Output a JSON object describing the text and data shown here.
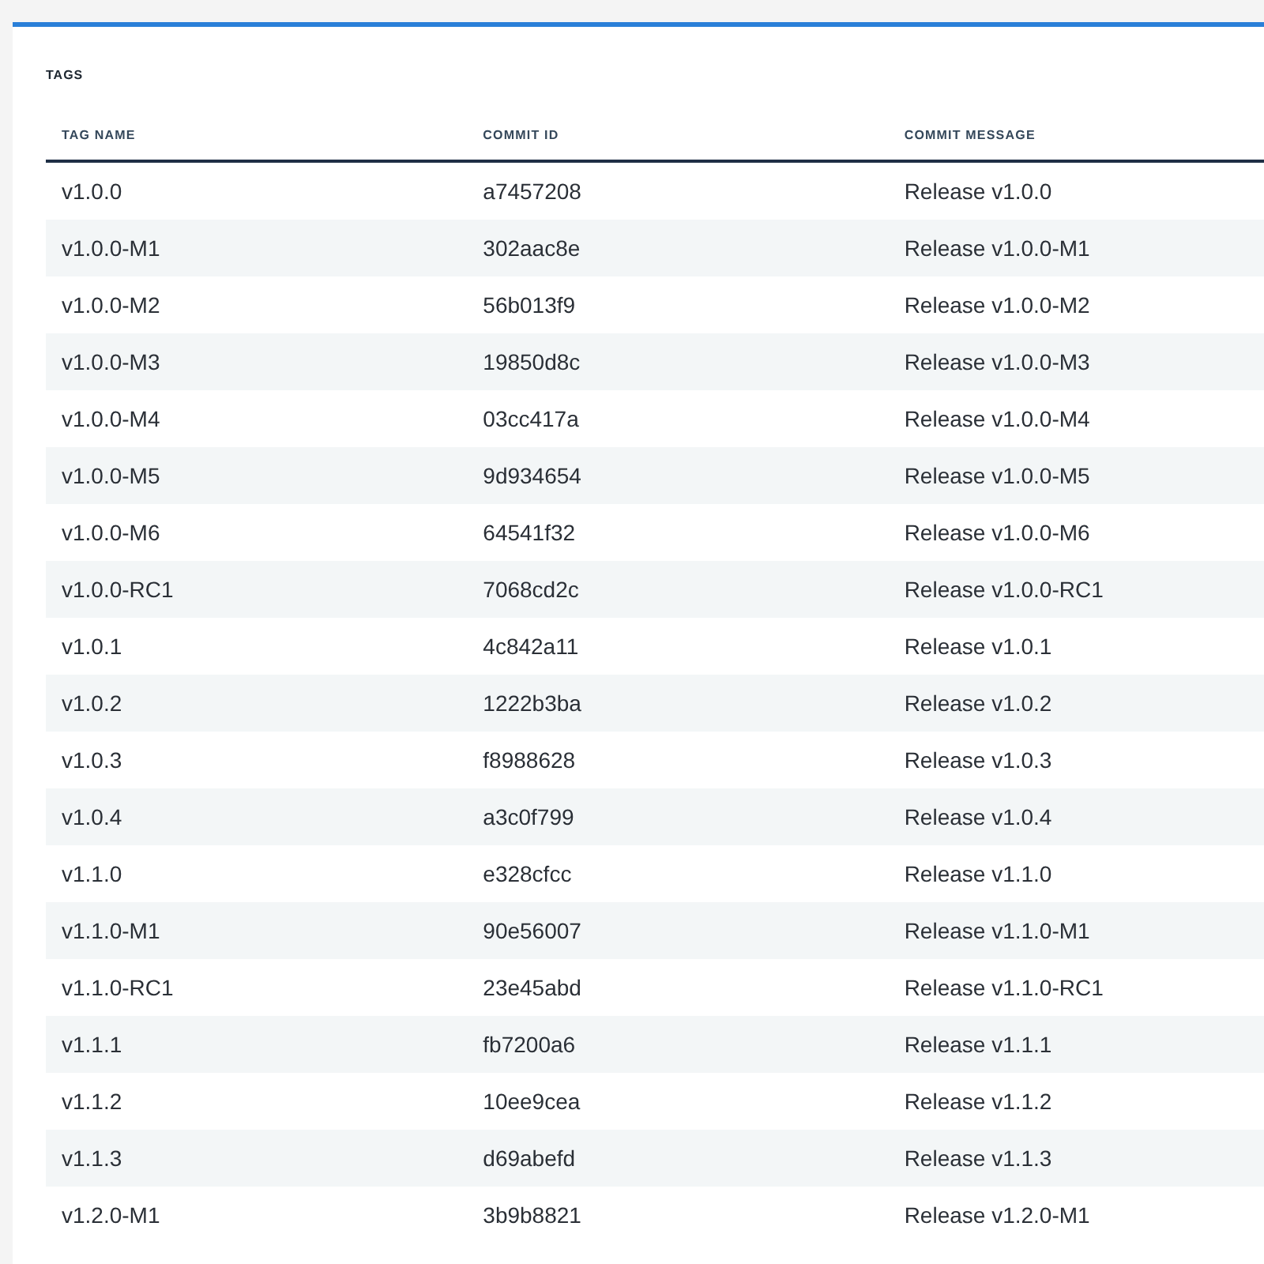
{
  "panel": {
    "title": "TAGS"
  },
  "table": {
    "columns": [
      "TAG NAME",
      "COMMIT ID",
      "COMMIT MESSAGE"
    ],
    "rows": [
      {
        "tag_name": "v1.0.0",
        "commit_id": "a7457208",
        "commit_message": "Release v1.0.0"
      },
      {
        "tag_name": "v1.0.0-M1",
        "commit_id": "302aac8e",
        "commit_message": "Release v1.0.0-M1"
      },
      {
        "tag_name": "v1.0.0-M2",
        "commit_id": "56b013f9",
        "commit_message": "Release v1.0.0-M2"
      },
      {
        "tag_name": "v1.0.0-M3",
        "commit_id": "19850d8c",
        "commit_message": "Release v1.0.0-M3"
      },
      {
        "tag_name": "v1.0.0-M4",
        "commit_id": "03cc417a",
        "commit_message": "Release v1.0.0-M4"
      },
      {
        "tag_name": "v1.0.0-M5",
        "commit_id": "9d934654",
        "commit_message": "Release v1.0.0-M5"
      },
      {
        "tag_name": "v1.0.0-M6",
        "commit_id": "64541f32",
        "commit_message": "Release v1.0.0-M6"
      },
      {
        "tag_name": "v1.0.0-RC1",
        "commit_id": "7068cd2c",
        "commit_message": "Release v1.0.0-RC1"
      },
      {
        "tag_name": "v1.0.1",
        "commit_id": "4c842a11",
        "commit_message": "Release v1.0.1"
      },
      {
        "tag_name": "v1.0.2",
        "commit_id": "1222b3ba",
        "commit_message": "Release v1.0.2"
      },
      {
        "tag_name": "v1.0.3",
        "commit_id": "f8988628",
        "commit_message": "Release v1.0.3"
      },
      {
        "tag_name": "v1.0.4",
        "commit_id": "a3c0f799",
        "commit_message": "Release v1.0.4"
      },
      {
        "tag_name": "v1.1.0",
        "commit_id": "e328cfcc",
        "commit_message": "Release v1.1.0"
      },
      {
        "tag_name": "v1.1.0-M1",
        "commit_id": "90e56007",
        "commit_message": "Release v1.1.0-M1"
      },
      {
        "tag_name": "v1.1.0-RC1",
        "commit_id": "23e45abd",
        "commit_message": "Release v1.1.0-RC1"
      },
      {
        "tag_name": "v1.1.1",
        "commit_id": "fb7200a6",
        "commit_message": "Release v1.1.1"
      },
      {
        "tag_name": "v1.1.2",
        "commit_id": "10ee9cea",
        "commit_message": "Release v1.1.2"
      },
      {
        "tag_name": "v1.1.3",
        "commit_id": "d69abefd",
        "commit_message": "Release v1.1.3"
      },
      {
        "tag_name": "v1.2.0-M1",
        "commit_id": "3b9b8821",
        "commit_message": "Release v1.2.0-M1"
      }
    ]
  }
}
